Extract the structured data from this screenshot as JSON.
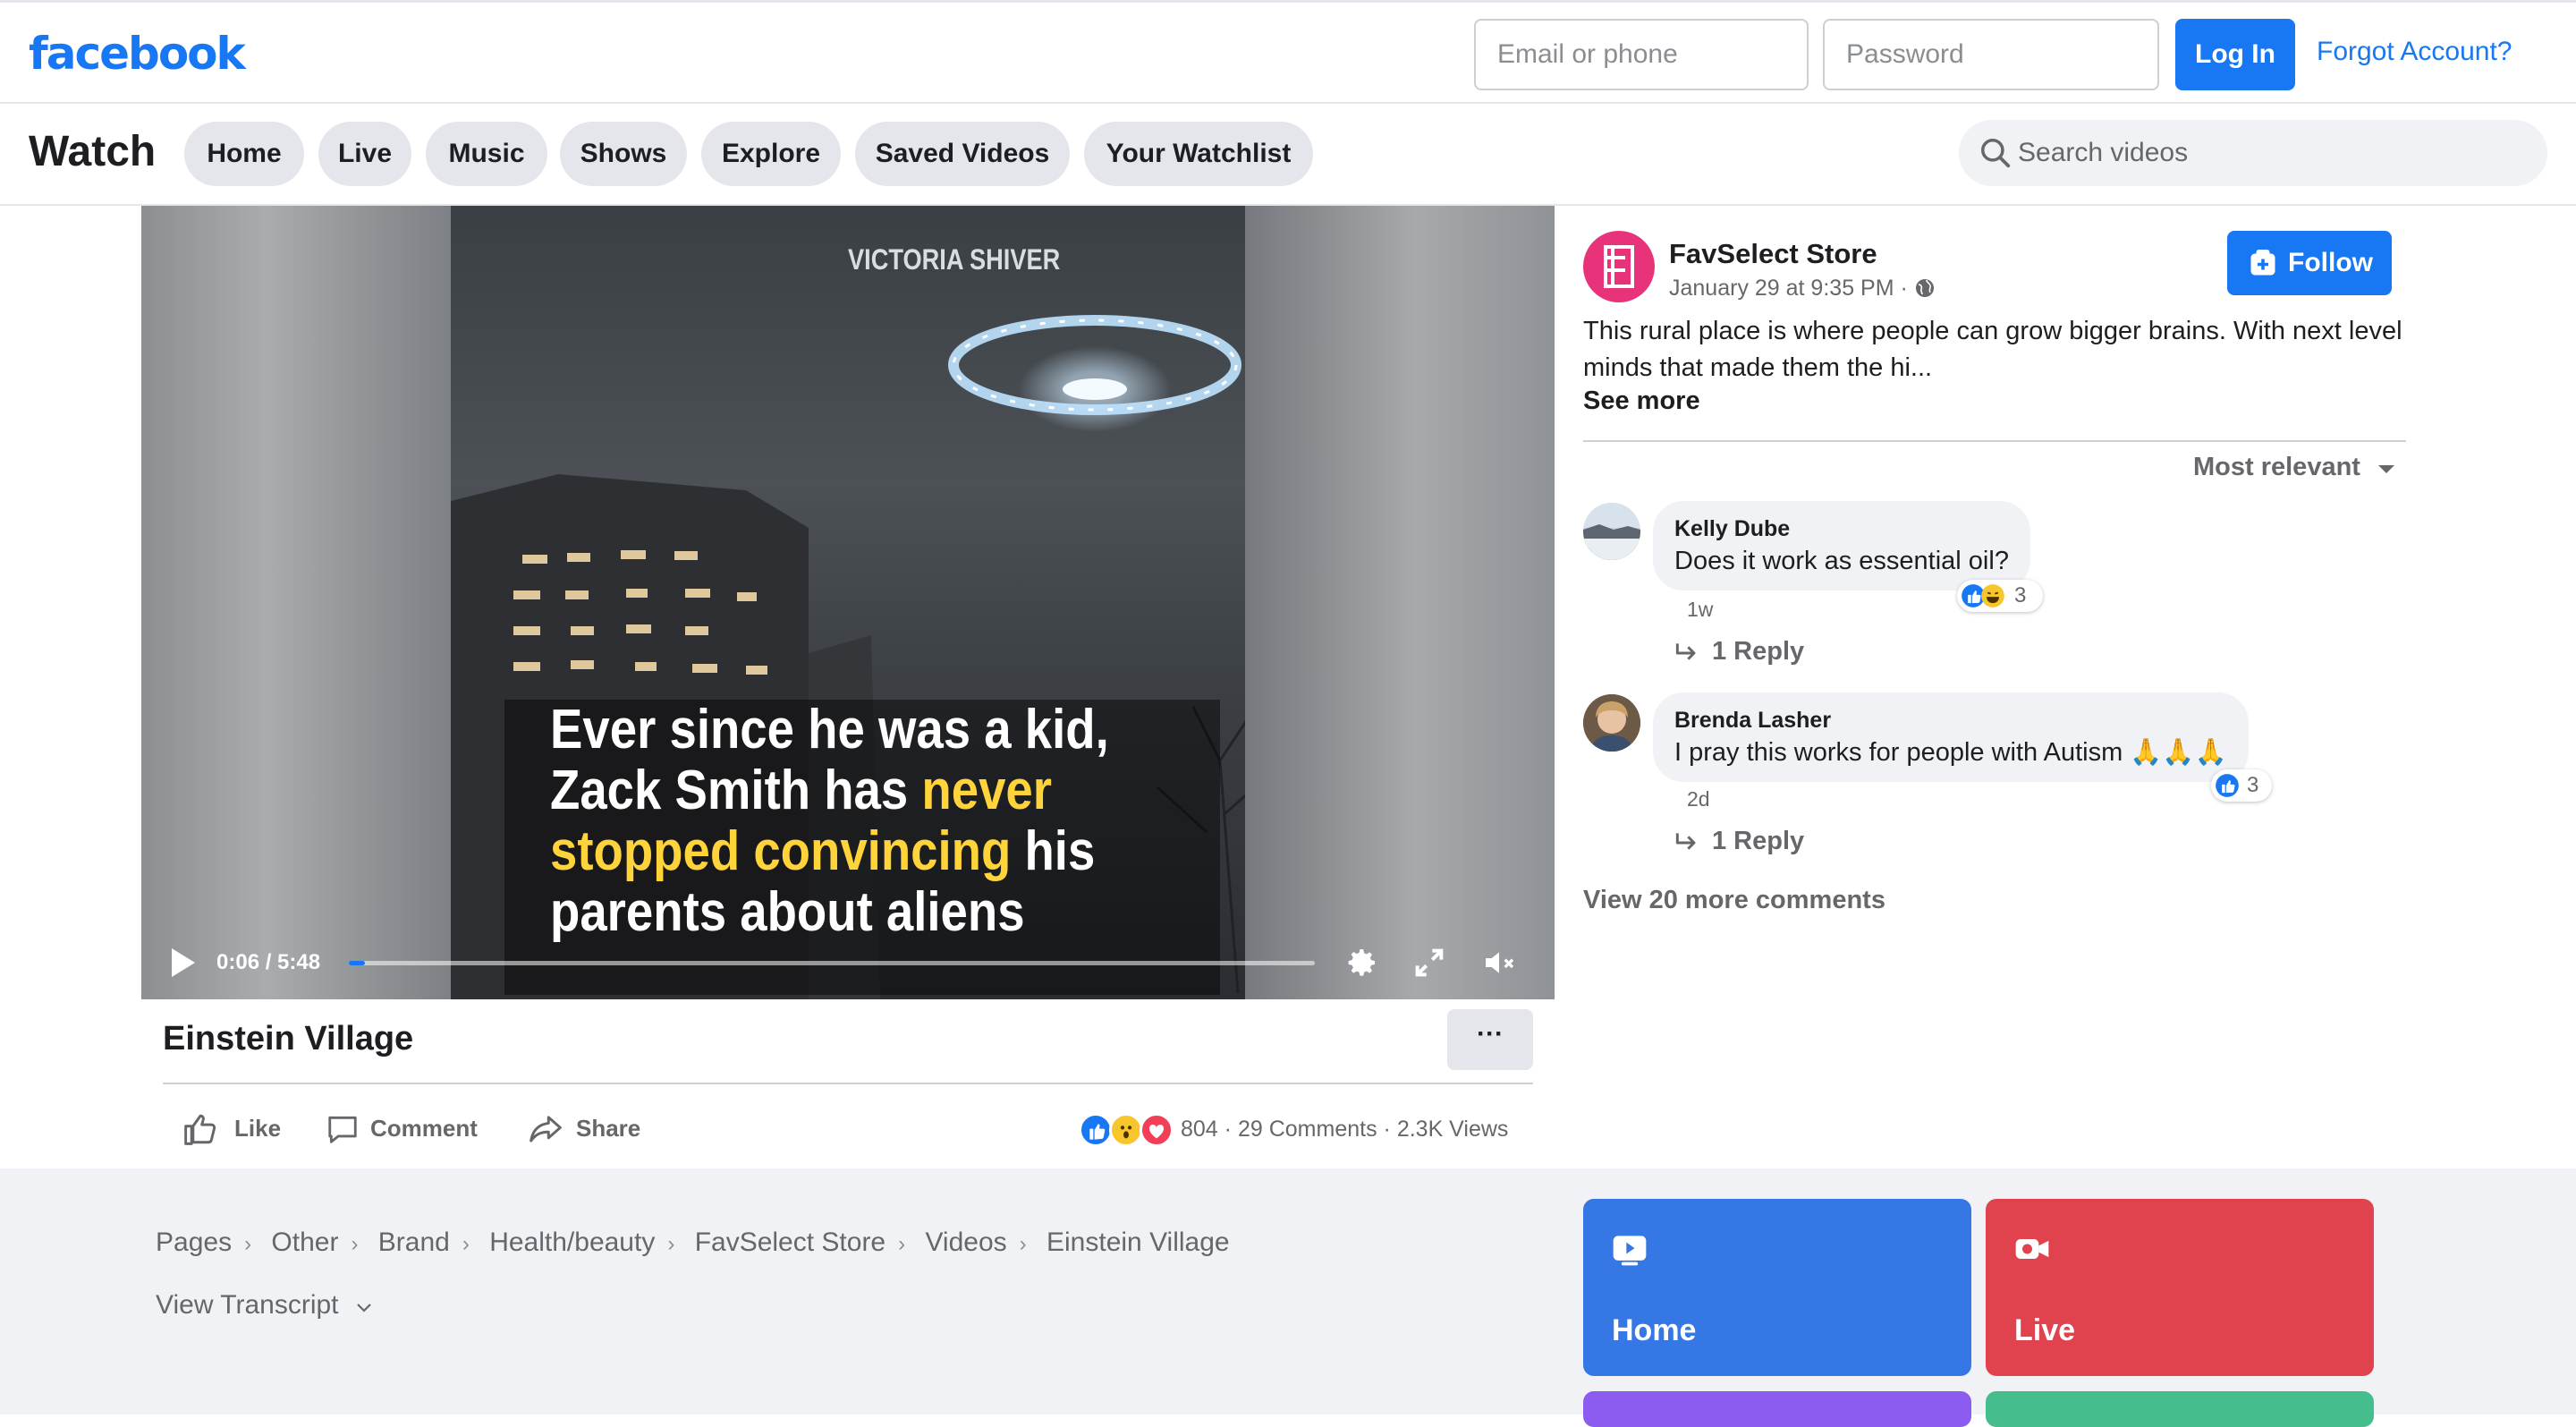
{
  "header": {
    "logo": "facebook",
    "email_placeholder": "Email or phone",
    "password_placeholder": "Password",
    "login_label": "Log In",
    "forgot_label": "Forgot Account?"
  },
  "watch_nav": {
    "title": "Watch",
    "tabs": [
      "Home",
      "Live",
      "Music",
      "Shows",
      "Explore",
      "Saved Videos",
      "Your Watchlist"
    ],
    "search_placeholder": "Search videos"
  },
  "video": {
    "watermark": "VICTORIA SHIVER",
    "caption_lines": [
      [
        "Ever since he was a kid,",
        ""
      ],
      [
        "Zack Smith has ",
        "never"
      ],
      [
        "",
        "stopped convincing",
        " his"
      ],
      [
        "parents about aliens",
        ""
      ]
    ],
    "time": "0:06 / 5:48",
    "progress_fraction": 0.017,
    "title": "Einstein Village",
    "more_label": "···"
  },
  "actions": {
    "like": "Like",
    "comment": "Comment",
    "share": "Share",
    "reaction_count": "804",
    "comments_count": "29 Comments",
    "views": "2.3K Views",
    "stats_sep": "·"
  },
  "post": {
    "page_name": "FavSelect Store",
    "date": "January 29 at 9:35 PM ·",
    "follow_label": "Follow",
    "text": "This rural place is where people can grow bigger brains. With next level minds that made them the hi...",
    "see_more": "See more",
    "sort_label": "Most relevant"
  },
  "comments": [
    {
      "name": "Kelly Dube",
      "text": "Does it work as essential oil?",
      "reactions": "3",
      "time": "1w",
      "reply": "1 Reply"
    },
    {
      "name": "Brenda Lasher",
      "text": "I pray this works for people with Autism 🙏🙏🙏",
      "reactions": "3",
      "time": "2d",
      "reply": "1 Reply"
    }
  ],
  "view_more_comments": "View 20 more comments",
  "footer": {
    "breadcrumbs": [
      "Pages",
      "Other",
      "Brand",
      "Health/beauty",
      "FavSelect Store",
      "Videos",
      "Einstein Village"
    ],
    "view_transcript": "View Transcript",
    "tiles": [
      {
        "label": "Home",
        "color": "#3578e5",
        "icon": "video-play-icon"
      },
      {
        "label": "Live",
        "color": "#e0424e",
        "icon": "live-camera-icon"
      }
    ]
  },
  "colors": {
    "brand": "#1877f2",
    "text": "#1c1e21",
    "muted": "#65676b"
  }
}
